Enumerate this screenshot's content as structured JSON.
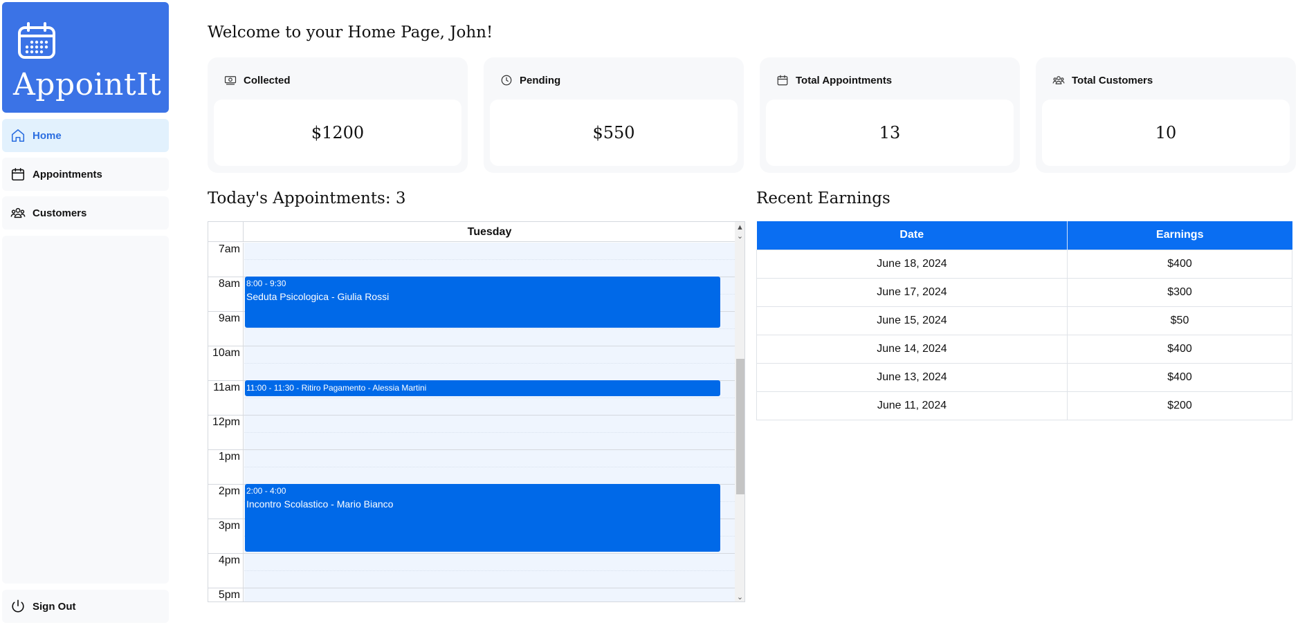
{
  "app": {
    "name": "AppointIt",
    "logo_icon": "calendar-icon",
    "accent": "#3b73e6"
  },
  "sidebar": {
    "items": [
      {
        "label": "Home",
        "icon": "home-icon",
        "active": true
      },
      {
        "label": "Appointments",
        "icon": "calendar-icon",
        "active": false
      },
      {
        "label": "Customers",
        "icon": "users-icon",
        "active": false
      }
    ],
    "sign_out": {
      "label": "Sign Out",
      "icon": "power-icon"
    }
  },
  "main": {
    "welcome": "Welcome to your Home Page, John!",
    "stats": [
      {
        "label": "Collected",
        "value": "$1200",
        "icon": "money-icon"
      },
      {
        "label": "Pending",
        "value": "$550",
        "icon": "clock-icon"
      },
      {
        "label": "Total Appointments",
        "value": "13",
        "icon": "calendar-icon"
      },
      {
        "label": "Total Customers",
        "value": "10",
        "icon": "users-icon"
      }
    ],
    "appointments_title": "Today's Appointments: 3",
    "calendar": {
      "day": "Tuesday",
      "hours": [
        "7am",
        "8am",
        "9am",
        "10am",
        "11am",
        "12pm",
        "1pm",
        "2pm",
        "3pm",
        "4pm",
        "5pm"
      ],
      "events": [
        {
          "time": "8:00 - 9:30",
          "title": "Seduta Psicologica - Giulia Rossi"
        },
        {
          "time": "11:00 - 11:30",
          "title": "Ritiro Pagamento - Alessia Martini",
          "combined": "11:00 - 11:30 - Ritiro Pagamento - Alessia Martini"
        },
        {
          "time": "2:00 - 4:00",
          "title": "Incontro Scolastico - Mario Bianco"
        }
      ],
      "event_color": "#0069e8"
    },
    "earnings": {
      "title": "Recent Earnings",
      "columns": [
        "Date",
        "Earnings"
      ],
      "rows": [
        [
          "June 18, 2024",
          "$400"
        ],
        [
          "June 17, 2024",
          "$300"
        ],
        [
          "June 15, 2024",
          "$50"
        ],
        [
          "June 14, 2024",
          "$400"
        ],
        [
          "June 13, 2024",
          "$400"
        ],
        [
          "June 11, 2024",
          "$200"
        ]
      ],
      "header_color": "#0a6ef2"
    }
  }
}
